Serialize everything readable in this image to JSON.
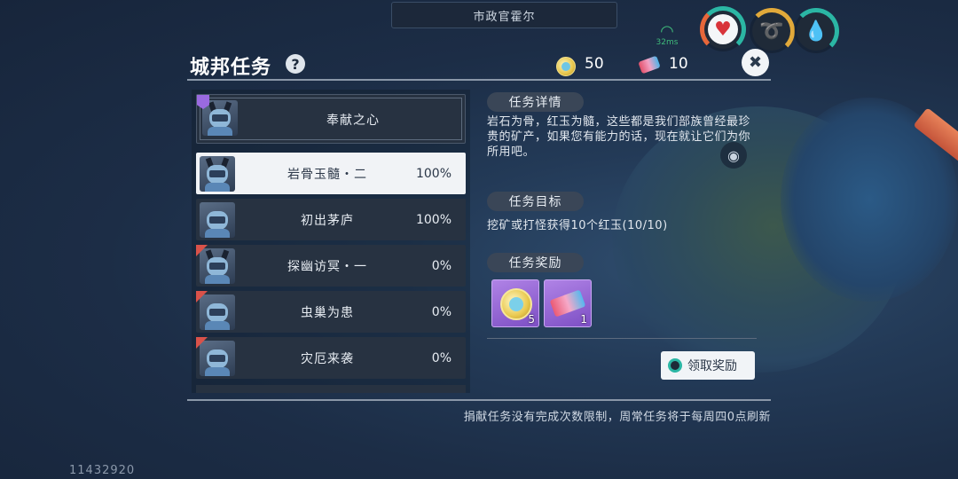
{
  "top_banner": "市政官霍尔",
  "status": {
    "ping": "32ms"
  },
  "header": {
    "title": "城邦任务",
    "help": "?",
    "coin_value": "50",
    "ticket_value": "10",
    "close": "✖"
  },
  "quests": {
    "featured": {
      "label": "奉献之心"
    },
    "rows": [
      {
        "label": "岩骨玉髓・二",
        "progress": "100%",
        "selected": true
      },
      {
        "label": "初出茅庐",
        "progress": "100%"
      },
      {
        "label": "探幽访冥・一",
        "progress": "0%"
      },
      {
        "label": "虫巢为患",
        "progress": "0%"
      },
      {
        "label": "灾厄来袭",
        "progress": "0%"
      }
    ]
  },
  "detail": {
    "section_detail": "任务详情",
    "description": "岩石为骨，红玉为髓，这些都是我们部族曾经最珍贵的矿产，如果您有能力的话，现在就让它们为你所用吧。",
    "section_goal": "任务目标",
    "goal": "挖矿或打怪获得10个红玉(10/10)",
    "section_reward": "任务奖励",
    "rewards": [
      {
        "icon": "coin-icon",
        "qty": "5"
      },
      {
        "icon": "ticket-icon",
        "qty": "1"
      }
    ],
    "claim_label": "领取奖励"
  },
  "notice": "捐献任务没有完成次数限制，周常任务将于每周四0点刷新",
  "uid": "11432920"
}
